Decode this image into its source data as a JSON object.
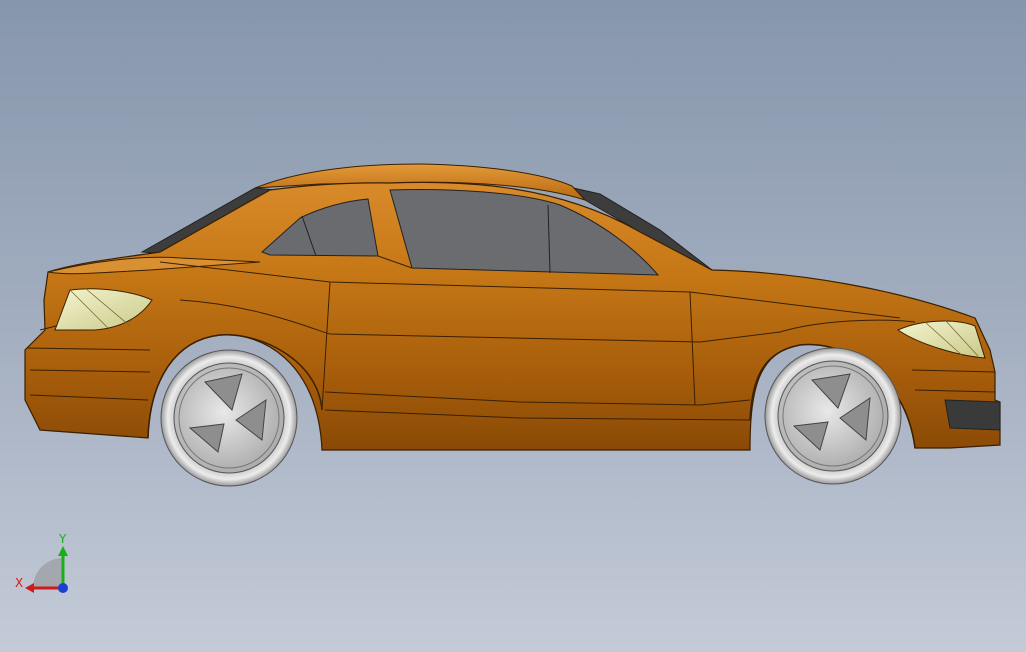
{
  "viewport": {
    "background_top": "#8696ac",
    "background_bottom": "#c4cbd8"
  },
  "model": {
    "body_color": "#b86a10",
    "body_dark": "#8a4a06",
    "glass_color": "#6b6d70",
    "lamp_color": "#e6e6b0",
    "wheel_color": "#d6d6d6"
  },
  "triad": {
    "x_label": "X",
    "y_label": "Y",
    "x_color": "#d11a1a",
    "y_color": "#18b018",
    "z_color": "#1a3fd1"
  }
}
